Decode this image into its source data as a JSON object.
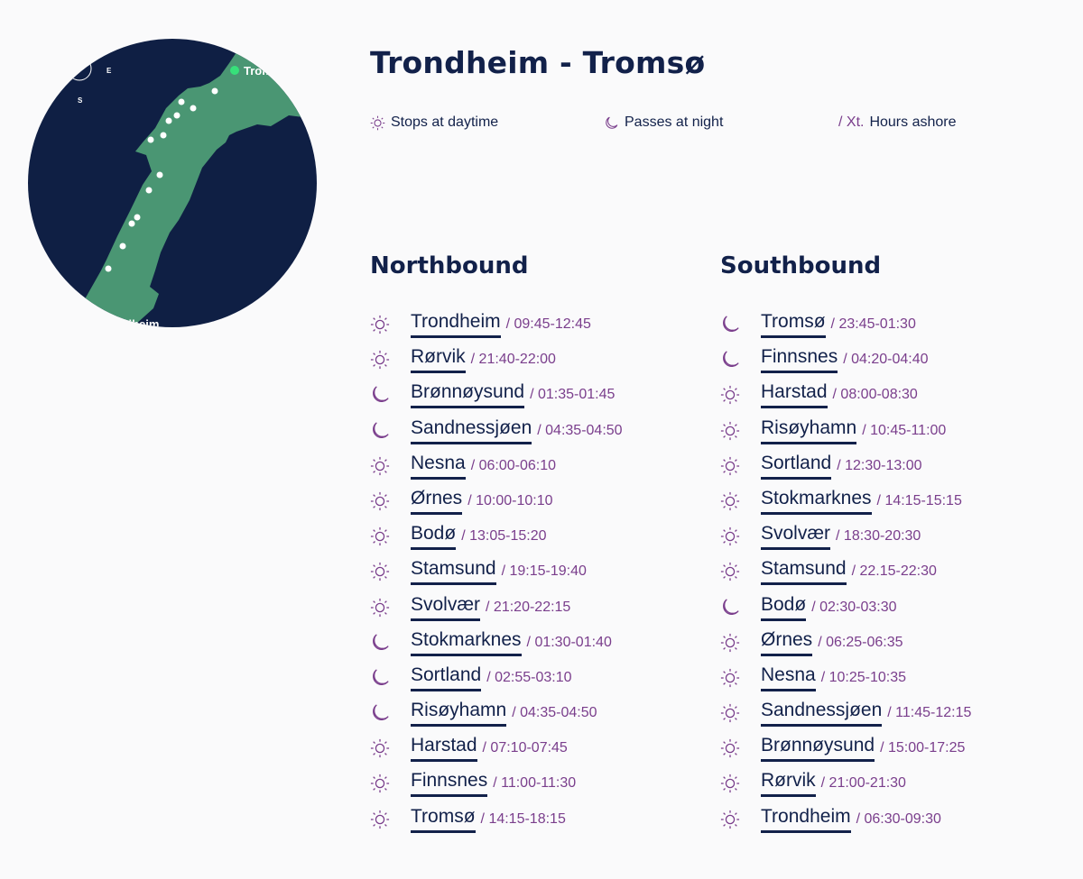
{
  "map": {
    "labels": {
      "end": "Tromsø",
      "start": "Trondheim"
    },
    "compass": {
      "east": "E",
      "south": "S"
    },
    "colors": {
      "sea": "#0f1f44",
      "land": "#4a9673",
      "end_marker": "#37e07a",
      "stop": "#ffffff"
    }
  },
  "title": "Trondheim - Tromsø",
  "legend": [
    {
      "icon": "sun-icon",
      "label": "Stops at daytime"
    },
    {
      "icon": "moon-icon",
      "label": "Passes at night"
    },
    {
      "prefix": "/ Xt.",
      "label": "Hours ashore"
    }
  ],
  "northbound": {
    "heading": "Northbound",
    "stops": [
      {
        "icon": "sun",
        "port": "Trondheim",
        "time": "/ 09:45-12:45"
      },
      {
        "icon": "sun",
        "port": "Rørvik",
        "time": "/ 21:40-22:00"
      },
      {
        "icon": "moon",
        "port": "Brønnøysund",
        "time": "/ 01:35-01:45"
      },
      {
        "icon": "moon",
        "port": "Sandnessjøen",
        "time": "/ 04:35-04:50"
      },
      {
        "icon": "sun",
        "port": "Nesna",
        "time": "/ 06:00-06:10"
      },
      {
        "icon": "sun",
        "port": "Ørnes",
        "time": "/ 10:00-10:10"
      },
      {
        "icon": "sun",
        "port": "Bodø",
        "time": "/ 13:05-15:20"
      },
      {
        "icon": "sun",
        "port": "Stamsund",
        "time": "/ 19:15-19:40"
      },
      {
        "icon": "sun",
        "port": "Svolvær",
        "time": "/ 21:20-22:15"
      },
      {
        "icon": "moon",
        "port": "Stokmarknes",
        "time": "/ 01:30-01:40"
      },
      {
        "icon": "moon",
        "port": "Sortland",
        "time": "/ 02:55-03:10"
      },
      {
        "icon": "moon",
        "port": "Risøyhamn",
        "time": "/ 04:35-04:50"
      },
      {
        "icon": "sun",
        "port": "Harstad",
        "time": "/ 07:10-07:45"
      },
      {
        "icon": "sun",
        "port": "Finnsnes",
        "time": "/ 11:00-11:30"
      },
      {
        "icon": "sun",
        "port": "Tromsø",
        "time": "/ 14:15-18:15"
      }
    ]
  },
  "southbound": {
    "heading": "Southbound",
    "stops": [
      {
        "icon": "moon",
        "port": "Tromsø",
        "time": "/ 23:45-01:30"
      },
      {
        "icon": "moon",
        "port": "Finnsnes",
        "time": "/ 04:20-04:40"
      },
      {
        "icon": "sun",
        "port": "Harstad",
        "time": "/ 08:00-08:30"
      },
      {
        "icon": "sun",
        "port": "Risøyhamn",
        "time": "/ 10:45-11:00"
      },
      {
        "icon": "sun",
        "port": "Sortland",
        "time": "/ 12:30-13:00"
      },
      {
        "icon": "sun",
        "port": "Stokmarknes",
        "time": "/ 14:15-15:15"
      },
      {
        "icon": "sun",
        "port": "Svolvær",
        "time": "/ 18:30-20:30"
      },
      {
        "icon": "sun",
        "port": "Stamsund",
        "time": "/ 22.15-22:30"
      },
      {
        "icon": "moon",
        "port": "Bodø",
        "time": "/ 02:30-03:30"
      },
      {
        "icon": "sun",
        "port": "Ørnes",
        "time": "/ 06:25-06:35"
      },
      {
        "icon": "sun",
        "port": "Nesna",
        "time": "/ 10:25-10:35"
      },
      {
        "icon": "sun",
        "port": "Sandnessjøen",
        "time": "/ 11:45-12:15"
      },
      {
        "icon": "sun",
        "port": "Brønnøysund",
        "time": "/ 15:00-17:25"
      },
      {
        "icon": "sun",
        "port": "Rørvik",
        "time": "/ 21:00-21:30"
      },
      {
        "icon": "sun",
        "port": "Trondheim",
        "time": "/ 06:30-09:30"
      }
    ]
  }
}
